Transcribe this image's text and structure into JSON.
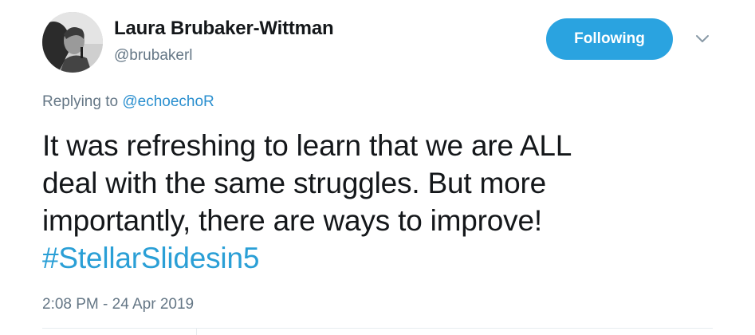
{
  "author": {
    "display_name": "Laura Brubaker-Wittman",
    "handle": "@brubakerl",
    "avatar_icon": "profile-photo"
  },
  "follow_button": {
    "label": "Following",
    "color": "#2aa3e0"
  },
  "menu": {
    "icon": "chevron-down-icon"
  },
  "reply": {
    "prefix": "Replying to",
    "mention": "@echoechoR"
  },
  "tweet": {
    "lines": [
      "It was refreshing to learn that we are ALL",
      "deal with the same struggles. But more",
      "importantly, there are ways to improve!"
    ],
    "hashtag": "#StellarSlidesin5"
  },
  "timestamp": "2:08 PM - 24 Apr 2019",
  "colors": {
    "text": "#14171a",
    "secondary": "#657786",
    "link": "#2a8fcf",
    "hashtag": "#2a9fd6"
  }
}
